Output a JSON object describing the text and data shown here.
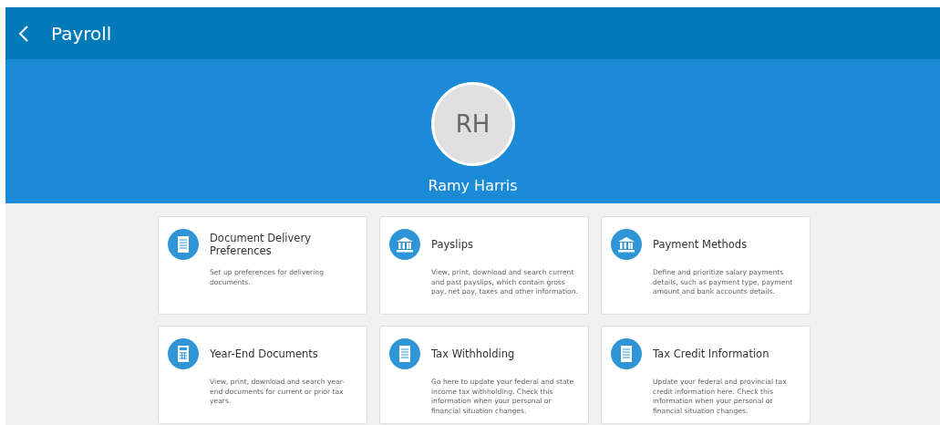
{
  "header": {
    "title": "Payroll"
  },
  "profile": {
    "initials": "RH",
    "name": "Ramy Harris"
  },
  "cards": [
    {
      "kind": "document",
      "title": "Document Delivery Preferences",
      "description": "Set up preferences for delivering documents."
    },
    {
      "kind": "bank",
      "title": "Payslips",
      "description": "View, print, download and search current and past payslips, which contain gross pay, net pay, taxes and other information."
    },
    {
      "kind": "bank",
      "title": "Payment Methods",
      "description": "Define and prioritize salary payments details, such as payment type, payment amount and bank accounts details."
    },
    {
      "kind": "calculator",
      "title": "Year-End Documents",
      "description": "View, print, download and search year-end documents for current or prior tax years."
    },
    {
      "kind": "document",
      "title": "Tax Withholding",
      "description": "Go here to update your federal and state income tax withholding. Check this information when your personal or financial situation changes."
    },
    {
      "kind": "document",
      "title": "Tax Credit Information",
      "description": "Update your federal and provincial tax credit information here. Check this information when your personal or financial situation changes."
    }
  ]
}
